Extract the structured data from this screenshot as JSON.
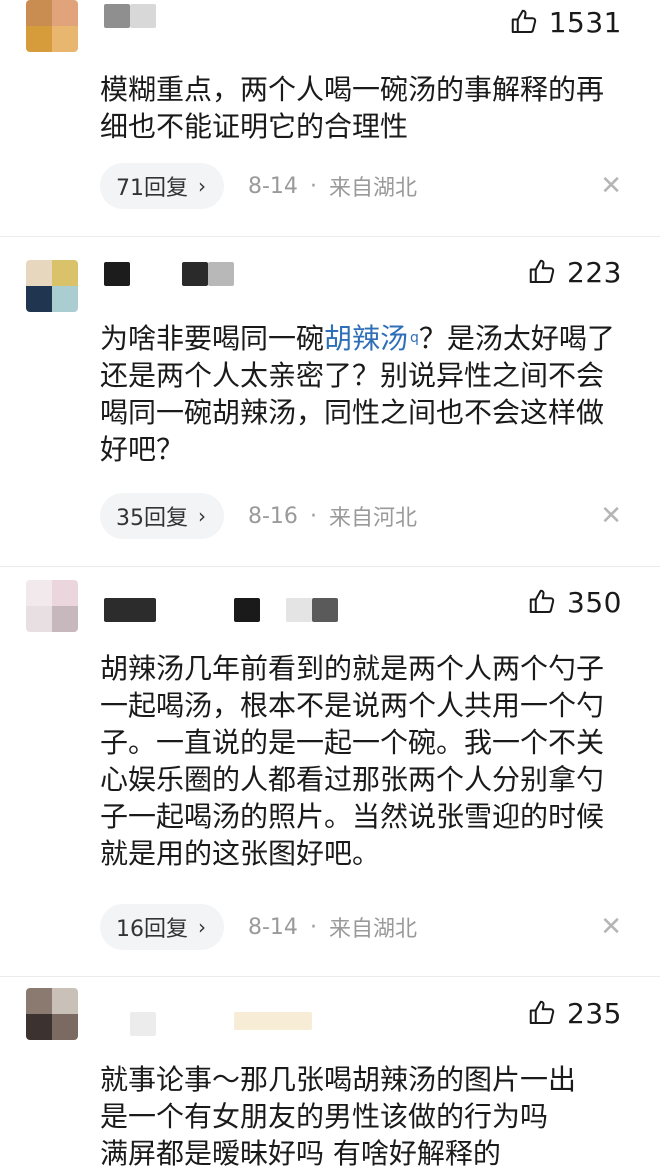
{
  "comments": [
    {
      "likes": "1531",
      "text": "模糊重点，两个人喝一碗汤的事解释的再细也不能证明它的合理性",
      "replies": "71回复",
      "date": "8-14",
      "location": "来自湖北"
    },
    {
      "likes": "223",
      "text_before": "为啥非要喝同一碗",
      "topic_link": "胡辣汤",
      "text_after": "？是汤太好喝了还是两个人太亲密了？别说异性之间不会喝同一碗胡辣汤，同性之间也不会这样做好吧？",
      "replies": "35回复",
      "date": "8-16",
      "location": "来自河北"
    },
    {
      "likes": "350",
      "text": "胡辣汤几年前看到的就是两个人两个勺子一起喝汤，根本不是说两个人共用一个勺子。一直说的是一起一个碗。我一个不关心娱乐圈的人都看过那张两个人分别拿勺子一起喝汤的照片。当然说张雪迎的时候就是用的这张图好吧。",
      "replies": "16回复",
      "date": "8-14",
      "location": "来自湖北"
    },
    {
      "likes": "235",
      "line1": "就事论事～那几张喝胡辣汤的图片一出",
      "line2": "是一个有女朋友的男性该做的行为吗",
      "line3": "满屏都是暧昧好吗 有啥好解释的"
    }
  ],
  "meta_separator": "·",
  "reply_chevron": "›",
  "close_glyph": "✕",
  "icons": {
    "like": "thumbs-up-icon",
    "close": "close-icon",
    "chevron": "chevron-right-icon",
    "search_hint": "search-icon"
  },
  "colors": {
    "link": "#2f6fb8",
    "meta": "#9a9a9a",
    "pill_bg": "#f3f4f6"
  }
}
